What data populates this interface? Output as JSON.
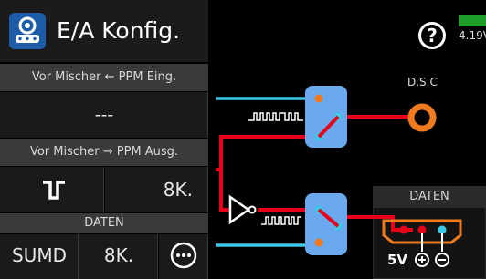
{
  "header": {
    "title": "E/A Konfig."
  },
  "status": {
    "voltage": "4.19V"
  },
  "left_panel": {
    "pre_mixer_ppm_in_label": "Vor Mischer ← PPM Eing.",
    "pre_mixer_ppm_in_value": "---",
    "pre_mixer_ppm_out_label": "Vor Mischer → PPM Ausg.",
    "ppm_out_channels": "8K.",
    "daten_label": "DATEN",
    "daten_protocol": "SUMD",
    "daten_channels": "8K."
  },
  "diagram": {
    "dsc_label": "D.S.C",
    "daten_label": "DATEN",
    "port_label": "5V"
  },
  "colors": {
    "signal_line": "#e8001a",
    "input_line": "#3fc7e8",
    "switch_box": "#6aa9ee",
    "dsc_ring": "#f07b1e",
    "battery": "#1e9e2a"
  }
}
